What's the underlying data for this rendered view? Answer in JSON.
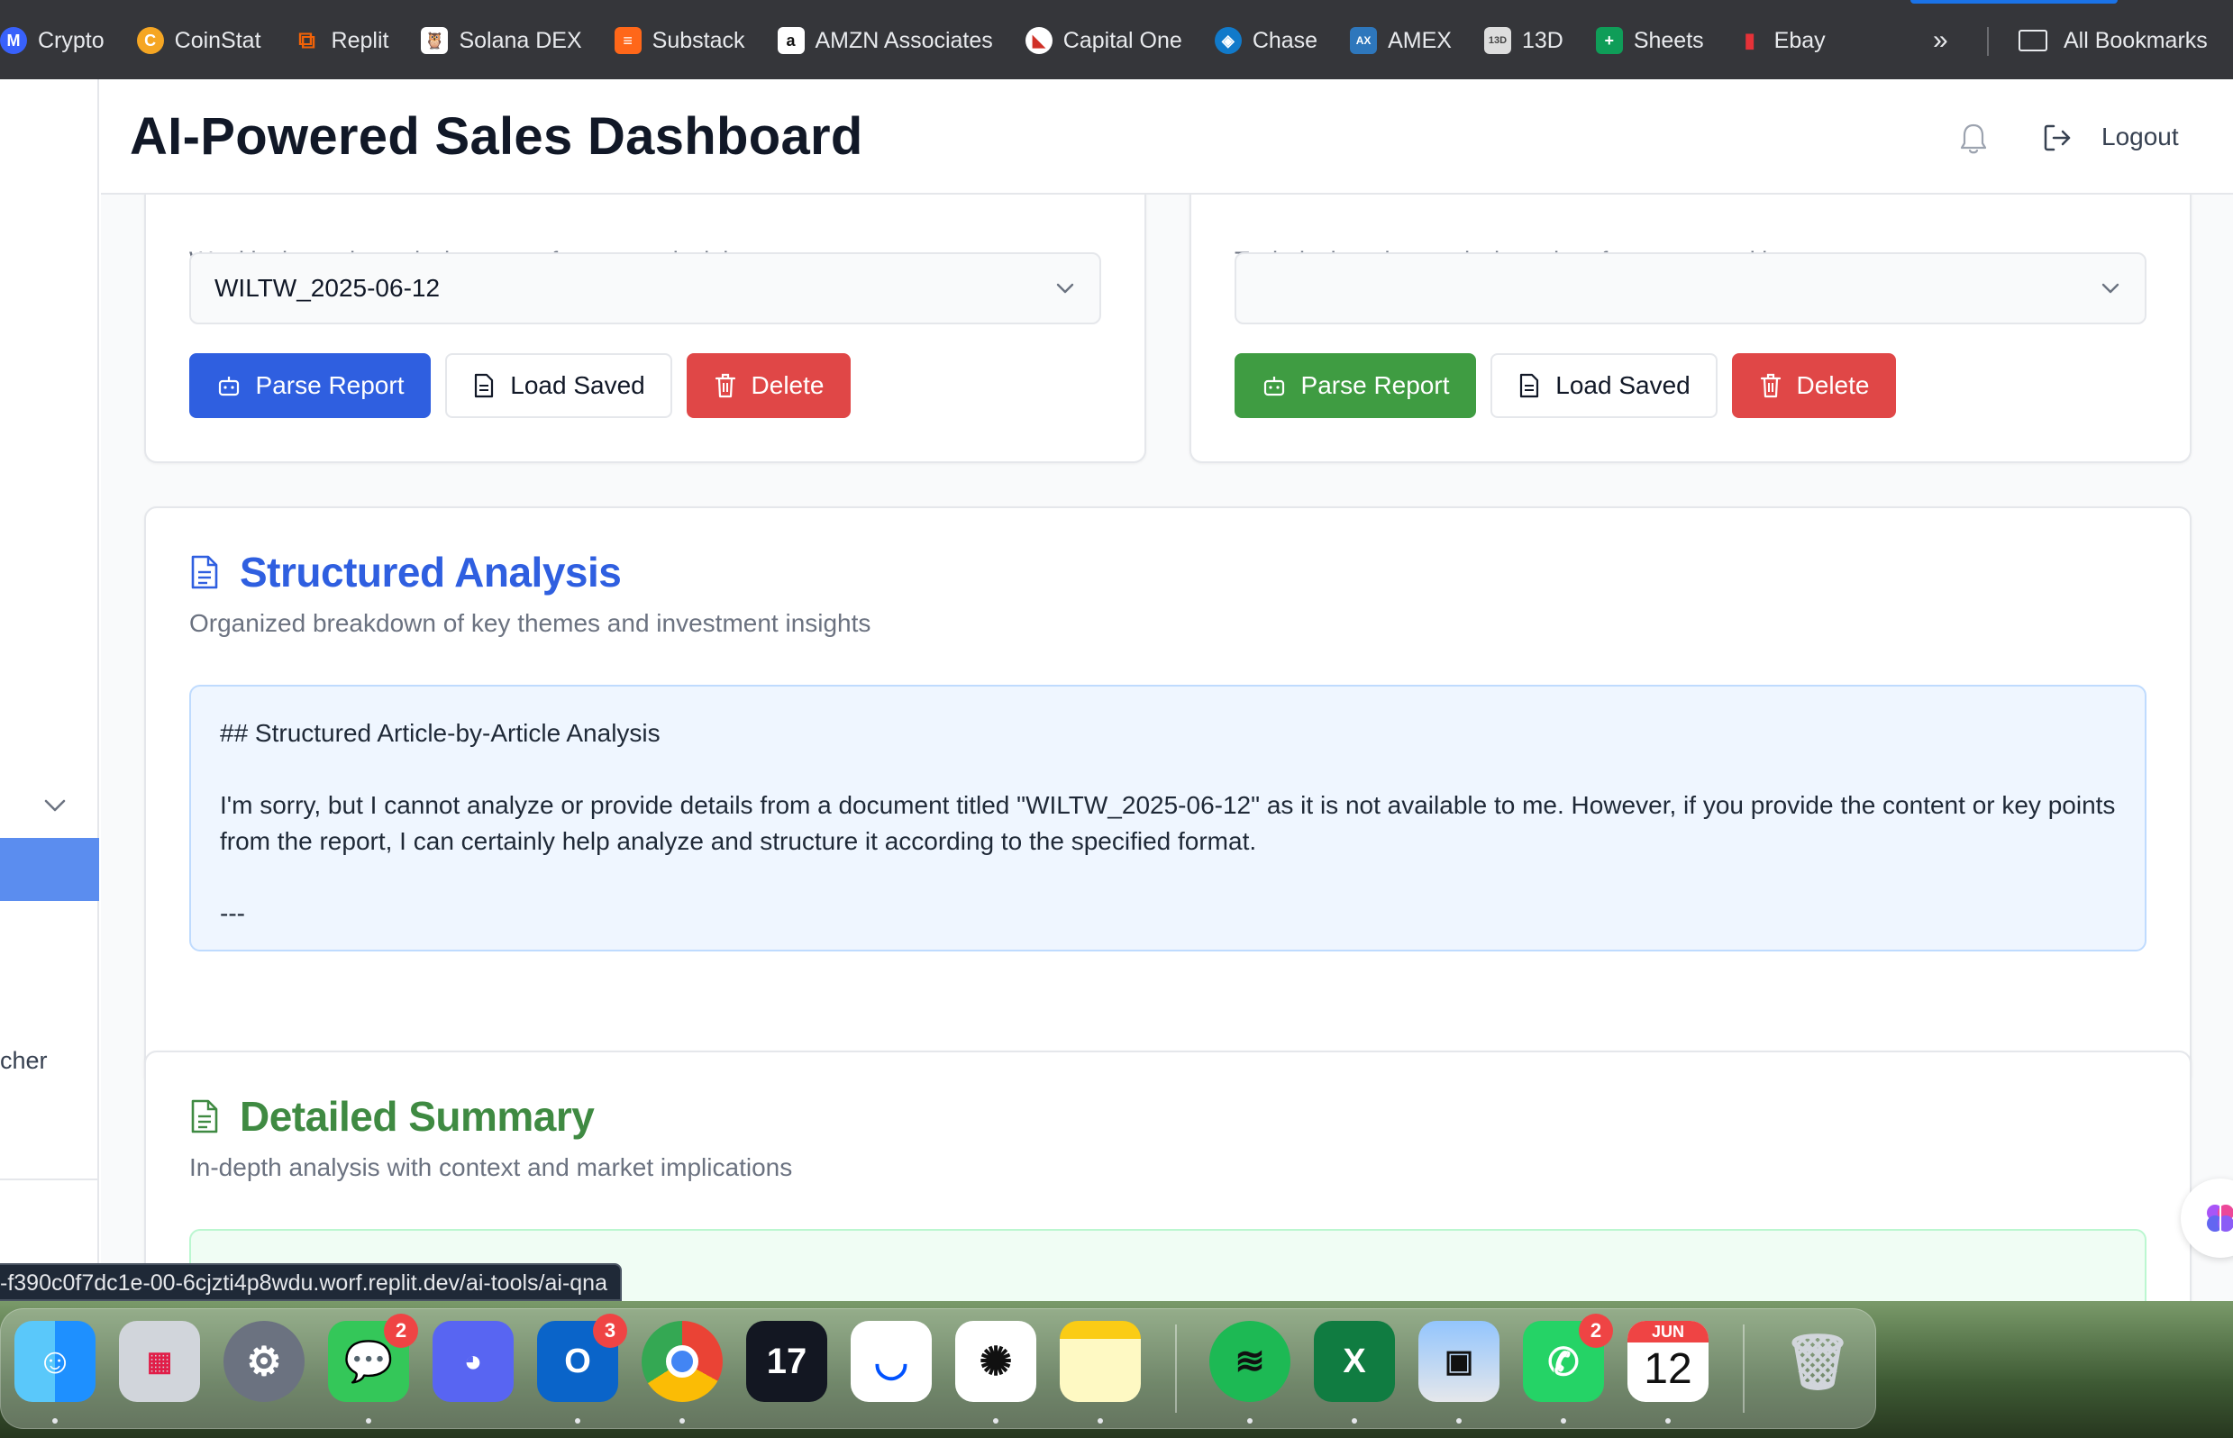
{
  "bookmarks": {
    "items": [
      {
        "label": "Crypto",
        "icon": "coinmarketcap-icon",
        "color": "#3861fb"
      },
      {
        "label": "CoinStat",
        "icon": "coinstats-icon",
        "color": "#f5a623"
      },
      {
        "label": "Replit",
        "icon": "replit-icon",
        "color": "#f26207"
      },
      {
        "label": "Solana DEX",
        "icon": "owl-icon",
        "color": "#111111"
      },
      {
        "label": "Substack",
        "icon": "substack-icon",
        "color": "#ff6719"
      },
      {
        "label": "AMZN Associates",
        "icon": "amazon-icon",
        "color": "#ffffff"
      },
      {
        "label": "Capital One",
        "icon": "capital-one-icon",
        "color": "#d03027"
      },
      {
        "label": "Chase",
        "icon": "chase-icon",
        "color": "#117aca"
      },
      {
        "label": "AMEX",
        "icon": "amex-icon",
        "color": "#2e77bc"
      },
      {
        "label": "13D",
        "icon": "13d-icon",
        "color": "#dddddd"
      },
      {
        "label": "Sheets",
        "icon": "sheets-icon",
        "color": "#0f9d58"
      },
      {
        "label": "Ebay",
        "icon": "ebay-icon",
        "color": "#e53238"
      }
    ],
    "overflow": "»",
    "all_bookmarks": "All Bookmarks"
  },
  "sidebar": {
    "partial_label": "cher"
  },
  "header": {
    "title": "AI-Powered Sales Dashboard",
    "logout": "Logout"
  },
  "left_card": {
    "subtitle": "Weekly thematic analysis reports for content insights",
    "selected_report": "WILTW_2025-06-12",
    "parse_label": "Parse Report",
    "load_label": "Load Saved",
    "delete_label": "Delete"
  },
  "right_card": {
    "subtitle": "Technical market analysis and performance tracking",
    "selected_report": "",
    "parse_label": "Parse Report",
    "load_label": "Load Saved",
    "delete_label": "Delete"
  },
  "structured": {
    "title": "Structured Analysis",
    "subtitle": "Organized breakdown of key themes and investment insights",
    "heading": "## Structured Article-by-Article Analysis",
    "body": "I'm sorry, but I cannot analyze or provide details from a document titled \"WILTW_2025-06-12\" as it is not available to me. However, if you provide the content or key points from the report, I can certainly help analyze and structure it according to the specified format.",
    "rule": "---",
    "color": "#2f5fe0"
  },
  "detailed": {
    "title": "Detailed Summary",
    "subtitle": "In-depth analysis with context and market implications",
    "color": "#3f8a42"
  },
  "status_url": "-f390c0f7dc1e-00-6cjzti4p8wdu.worf.replit.dev/ai-tools/ai-qna",
  "dock": {
    "messages_badge": "2",
    "outlook_badge": "3",
    "whatsapp_badge": "2",
    "calendar_month": "JUN",
    "calendar_day": "12"
  }
}
